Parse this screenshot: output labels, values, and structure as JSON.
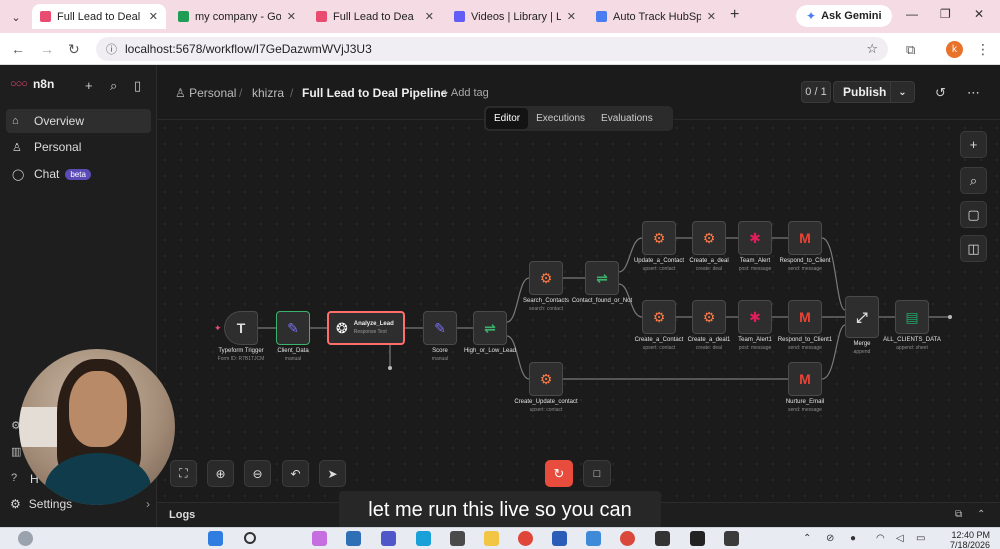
{
  "browser": {
    "tabs": [
      {
        "title": "Full Lead to Deal",
        "active": true,
        "color": "#ea4b71"
      },
      {
        "title": "my company - Goo",
        "active": false,
        "color": "#1f9d55"
      },
      {
        "title": "Full Lead to Dea",
        "active": false,
        "color": "#ea4b71"
      },
      {
        "title": "Videos | Library | Lo",
        "active": false,
        "color": "#625df5"
      },
      {
        "title": "Auto Track HubSpo",
        "active": false,
        "color": "#4a7cf2"
      }
    ],
    "gemini_label": "Ask Gemini",
    "url": "localhost:5678/workflow/I7GeDazwmWVjJ3U3",
    "profile_initial": "k"
  },
  "sidebar": {
    "brand": "n8n",
    "items": [
      {
        "label": "Overview",
        "icon": "home-icon",
        "active": true
      },
      {
        "label": "Personal",
        "icon": "user-icon",
        "active": false
      },
      {
        "label": "Chat",
        "icon": "chat-icon",
        "active": false,
        "badge": "beta"
      }
    ],
    "help_label": "H",
    "settings_label": "Settings"
  },
  "header": {
    "breadcrumb_personal": "Personal",
    "breadcrumb_folder": "khizra",
    "workflow_title": "Full Lead to Deal Pipeline",
    "add_tag": "+ Add tag",
    "counter": "0 / 1",
    "publish": "Publish"
  },
  "mode_tabs": [
    {
      "label": "Editor",
      "active": true
    },
    {
      "label": "Executions",
      "active": false
    },
    {
      "label": "Evaluations",
      "active": false
    }
  ],
  "nodes": [
    {
      "id": "typeform",
      "label": "Typeform Trigger",
      "sub": "Form ID: R7B1TJCM",
      "icon": "T",
      "icon_color": "#dddddd"
    },
    {
      "id": "client_data",
      "label": "Client_Data",
      "sub": "manual",
      "icon": "✎",
      "icon_color": "#7b6ff0"
    },
    {
      "id": "analyze",
      "label": "Analyze_Lead",
      "sub": "Response Text",
      "icon": "❂",
      "icon_color": "#ffffff"
    },
    {
      "id": "score",
      "label": "Score",
      "sub": "manual",
      "icon": "✎",
      "icon_color": "#7b6ff0"
    },
    {
      "id": "high_low",
      "label": "High_or_Low_Lead",
      "sub": "",
      "icon": "⇌",
      "icon_color": "#3bb36d"
    },
    {
      "id": "search",
      "label": "Search_Contacts",
      "sub": "search: contact",
      "icon": "⚙",
      "icon_color": "#ff7a45"
    },
    {
      "id": "found",
      "label": "Contact_found_or_Not",
      "sub": "",
      "icon": "⇌",
      "icon_color": "#3bb36d"
    },
    {
      "id": "update_contact",
      "label": "Update_a_Contact",
      "sub": "upsert: contact",
      "icon": "⚙",
      "icon_color": "#ff7a45"
    },
    {
      "id": "create_deal",
      "label": "Create_a_deal",
      "sub": "create: deal",
      "icon": "⚙",
      "icon_color": "#ff7a45"
    },
    {
      "id": "team_alert",
      "label": "Team_Alert",
      "sub": "post: message",
      "icon": "✱",
      "icon_color": "#e01e5a"
    },
    {
      "id": "respond",
      "label": "Respond_to_Client",
      "sub": "send: message",
      "icon": "M",
      "icon_color": "#ea4335"
    },
    {
      "id": "create_contact",
      "label": "Create_a_Contact",
      "sub": "upsert: contact",
      "icon": "⚙",
      "icon_color": "#ff7a45"
    },
    {
      "id": "create_deal1",
      "label": "Create_a_deal1",
      "sub": "create: deal",
      "icon": "⚙",
      "icon_color": "#ff7a45"
    },
    {
      "id": "team_alert1",
      "label": "Team_Alert1",
      "sub": "post: message",
      "icon": "✱",
      "icon_color": "#e01e5a"
    },
    {
      "id": "respond1",
      "label": "Respond_to_Client1",
      "sub": "send: message",
      "icon": "M",
      "icon_color": "#ea4335"
    },
    {
      "id": "merge",
      "label": "Merge",
      "sub": "append",
      "icon": "⤢",
      "icon_color": "#dddddd"
    },
    {
      "id": "all_clients",
      "label": "ALL_CLIENTS_DATA",
      "sub": "append: sheet",
      "icon": "▤",
      "icon_color": "#23a566"
    },
    {
      "id": "create_update",
      "label": "Create_Update_contact",
      "sub": "upsert: contact",
      "icon": "⚙",
      "icon_color": "#ff7a45"
    },
    {
      "id": "nurture",
      "label": "Nurture_Email",
      "sub": "send: message",
      "icon": "M",
      "icon_color": "#ea4335"
    }
  ],
  "logs_label": "Logs",
  "subtitle": "let me run this live so you can",
  "taskbar": {
    "time": "12:40 PM",
    "date": "7/18/2026"
  }
}
